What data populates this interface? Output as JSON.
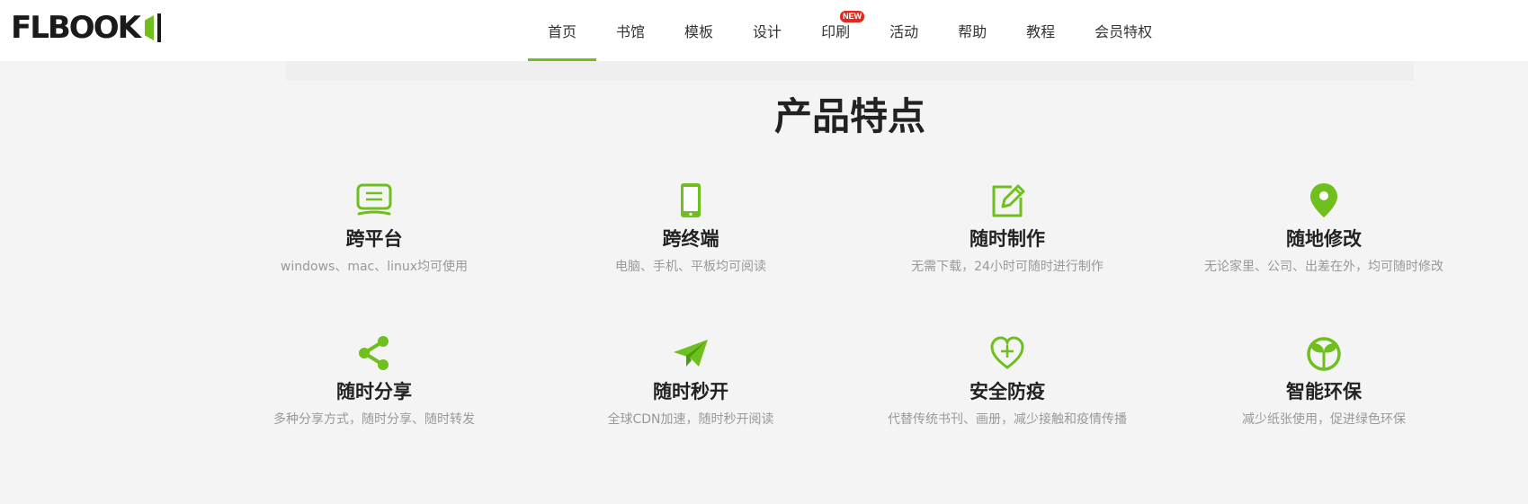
{
  "header": {
    "logo_text": "FLBOOK",
    "nav": [
      {
        "label": "首页",
        "active": true
      },
      {
        "label": "书馆"
      },
      {
        "label": "模板"
      },
      {
        "label": "设计"
      },
      {
        "label": "印刷",
        "badge": "NEW"
      },
      {
        "label": "活动"
      },
      {
        "label": "帮助"
      },
      {
        "label": "教程"
      },
      {
        "label": "会员特权"
      }
    ]
  },
  "colors": {
    "accent": "#6fbf1f",
    "badge": "#e8271b",
    "title": "#222222",
    "muted": "#999999",
    "background": "#f4f4f4"
  },
  "main": {
    "title": "产品特点",
    "features": [
      {
        "icon": "monitor-icon",
        "name": "跨平台",
        "desc": "windows、mac、linux均可使用"
      },
      {
        "icon": "mobile-phone-icon",
        "name": "跨终端",
        "desc": "电脑、手机、平板均可阅读"
      },
      {
        "icon": "edit-icon",
        "name": "随时制作",
        "desc": "无需下载，24小时可随时进行制作"
      },
      {
        "icon": "location-pin-icon",
        "name": "随地修改",
        "desc": "无论家里、公司、出差在外，均可随时修改"
      },
      {
        "icon": "share-icon",
        "name": "随时分享",
        "desc": "多种分享方式，随时分享、随时转发"
      },
      {
        "icon": "paper-plane-icon",
        "name": "随时秒开",
        "desc": "全球CDN加速，随时秒开阅读"
      },
      {
        "icon": "heart-plus-icon",
        "name": "安全防疫",
        "desc": "代替传统书刊、画册，减少接触和疫情传播"
      },
      {
        "icon": "sprout-icon",
        "name": "智能环保",
        "desc": "减少纸张使用，促进绿色环保"
      }
    ]
  }
}
